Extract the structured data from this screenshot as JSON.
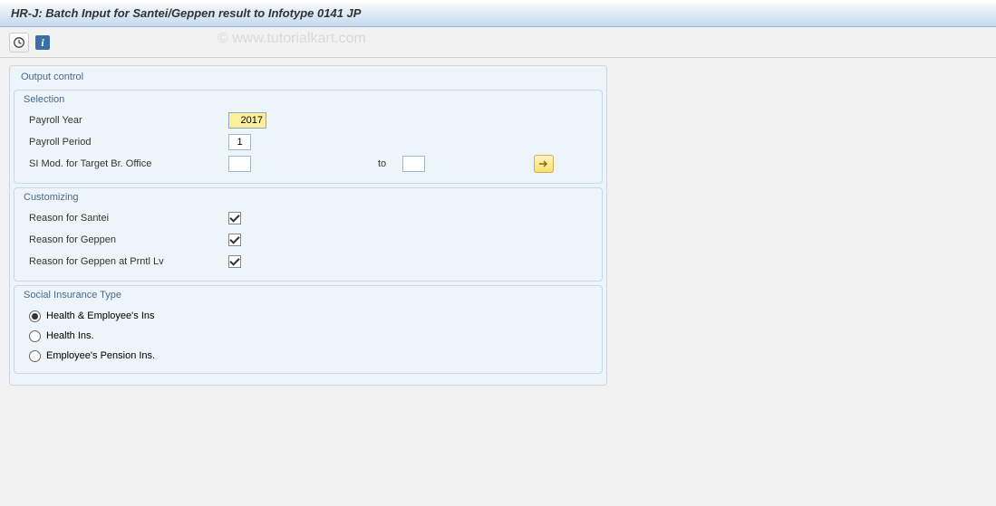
{
  "title": "HR-J: Batch Input for Santei/Geppen result to Infotype 0141 JP",
  "watermark": "© www.tutorialkart.com",
  "output_control": {
    "label": "Output control",
    "selection": {
      "label": "Selection",
      "payroll_year": {
        "label": "Payroll Year",
        "value": "2017"
      },
      "payroll_period": {
        "label": "Payroll Period",
        "value": "1"
      },
      "si_mod": {
        "label": "SI Mod. for Target Br. Office",
        "value_from": "",
        "to_label": "to",
        "value_to": ""
      }
    },
    "customizing": {
      "label": "Customizing",
      "reason_santei": {
        "label": "Reason for Santei",
        "checked": true
      },
      "reason_geppen": {
        "label": "Reason for Geppen",
        "checked": true
      },
      "reason_geppen_prntl": {
        "label": "Reason for Geppen at Prntl Lv",
        "checked": true
      }
    },
    "si_type": {
      "label": "Social Insurance Type",
      "options": [
        {
          "label": "Health & Employee's Ins",
          "selected": true
        },
        {
          "label": "Health Ins.",
          "selected": false
        },
        {
          "label": "Employee's Pension Ins.",
          "selected": false
        }
      ]
    }
  }
}
